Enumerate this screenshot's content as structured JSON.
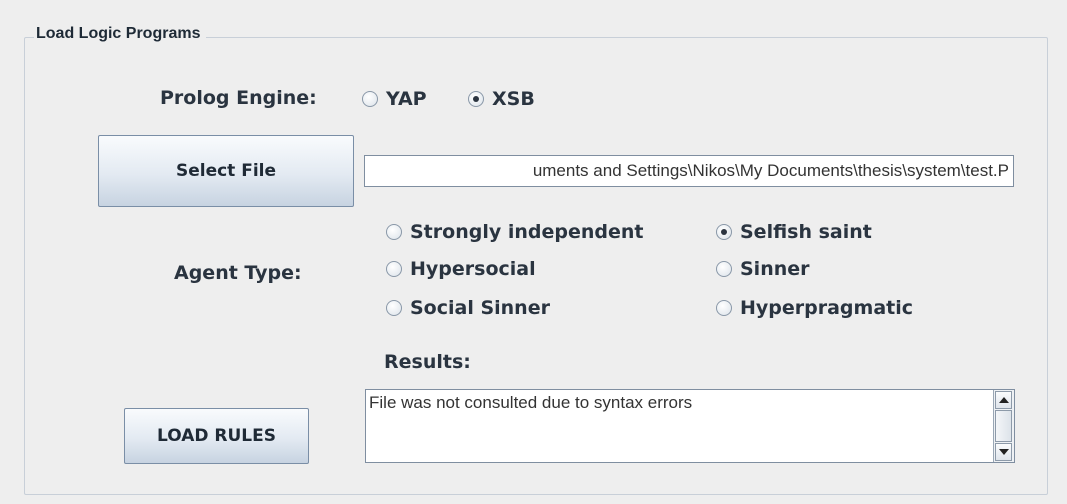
{
  "panel": {
    "title": "Load Logic Programs"
  },
  "engine": {
    "label": "Prolog Engine:",
    "options": [
      {
        "label": "YAP",
        "selected": false
      },
      {
        "label": "XSB",
        "selected": true
      }
    ]
  },
  "file": {
    "button_label": "Select File",
    "path_visible": "uments and Settings\\Nikos\\My Documents\\thesis\\system\\test.P"
  },
  "agent": {
    "label": "Agent Type:",
    "options": [
      {
        "label": "Strongly independent",
        "selected": false
      },
      {
        "label": "Selfish saint",
        "selected": true
      },
      {
        "label": "Hypersocial",
        "selected": false
      },
      {
        "label": "Sinner",
        "selected": false
      },
      {
        "label": "Social Sinner",
        "selected": false
      },
      {
        "label": "Hyperpragmatic",
        "selected": false
      }
    ]
  },
  "results": {
    "label": "Results:",
    "text": "File was not consulted due to syntax errors"
  },
  "actions": {
    "load_label": "LOAD RULES"
  },
  "icons": {
    "scroll_up": "arrow-up-icon",
    "scroll_down": "arrow-down-icon"
  }
}
